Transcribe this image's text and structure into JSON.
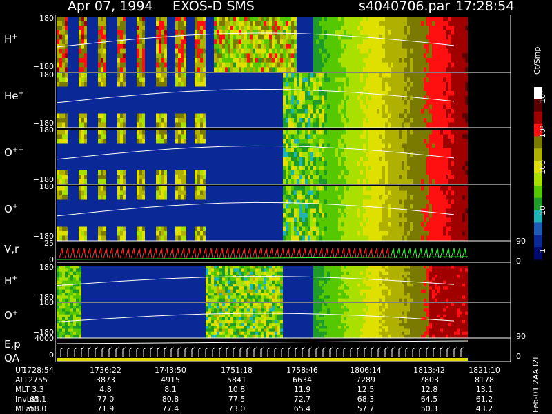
{
  "header": {
    "date": "Apr 07, 1994",
    "instrument": "EXOS-D SMS",
    "file": "s4040706.par",
    "time": "17:28:54"
  },
  "chart_data": {
    "type": "heatmap",
    "panels": [
      {
        "label": "H",
        "sup": "+",
        "ymax": "180",
        "ymin": "−180"
      },
      {
        "label": "He",
        "sup": "+",
        "ymax": "180",
        "ymin": "−180"
      },
      {
        "label": "O",
        "sup": "++",
        "ymax": "180",
        "ymin": "−180"
      },
      {
        "label": "O",
        "sup": "+",
        "ymax": "180",
        "ymin": "−180"
      },
      {
        "label": "V,r",
        "sup": "",
        "ymax": "25",
        "ymin": "0",
        "right_max": "90",
        "right_min": "0"
      },
      {
        "label": "H",
        "sup": "+",
        "ymax": "180",
        "ymin": "−180"
      },
      {
        "label": "O",
        "sup": "+",
        "ymax": "180",
        "ymin": "−180"
      },
      {
        "label": "E,p",
        "sup": "",
        "ymax": "4000",
        "ymin": "0",
        "right_max": "90",
        "right_min": "0",
        "sub_label": "QA"
      }
    ],
    "colorbar": {
      "units": "Ct/Smp",
      "ticks": [
        "10⁴",
        "10³",
        "100",
        "10",
        "1"
      ],
      "colors": [
        "#ffffff",
        "#5a0000",
        "#a00000",
        "#ff1010",
        "#7a7a00",
        "#b0b000",
        "#e0e000",
        "#aae000",
        "#55c800",
        "#1e9b28",
        "#1eb4b4",
        "#1e5ab4",
        "#0a2896",
        "#000a6e"
      ]
    },
    "ephemeris": {
      "rows": [
        {
          "name": "UT",
          "values": [
            "1728:54",
            "1736:22",
            "1743:50",
            "1751:18",
            "1758:46",
            "1806:14",
            "1813:42",
            "1821:10"
          ]
        },
        {
          "name": "ALT",
          "values": [
            "2755",
            "3873",
            "4915",
            "5841",
            "6634",
            "7289",
            "7803",
            "8178"
          ]
        },
        {
          "name": "MLT",
          "values": [
            "3.3",
            "4.8",
            "8.1",
            "10.8",
            "11.9",
            "12.5",
            "12.8",
            "13.1"
          ]
        },
        {
          "name": "InvLat",
          "values": [
            "65.1",
            "77.0",
            "80.8",
            "77.5",
            "72.7",
            "68.3",
            "64.5",
            "61.2"
          ]
        },
        {
          "name": "MLat",
          "values": [
            "58.0",
            "71.9",
            "77.4",
            "73.0",
            "65.4",
            "57.7",
            "50.3",
            "43.2"
          ]
        }
      ]
    }
  },
  "footer": {
    "vertical_label": "Feb-01  2AA32L"
  }
}
